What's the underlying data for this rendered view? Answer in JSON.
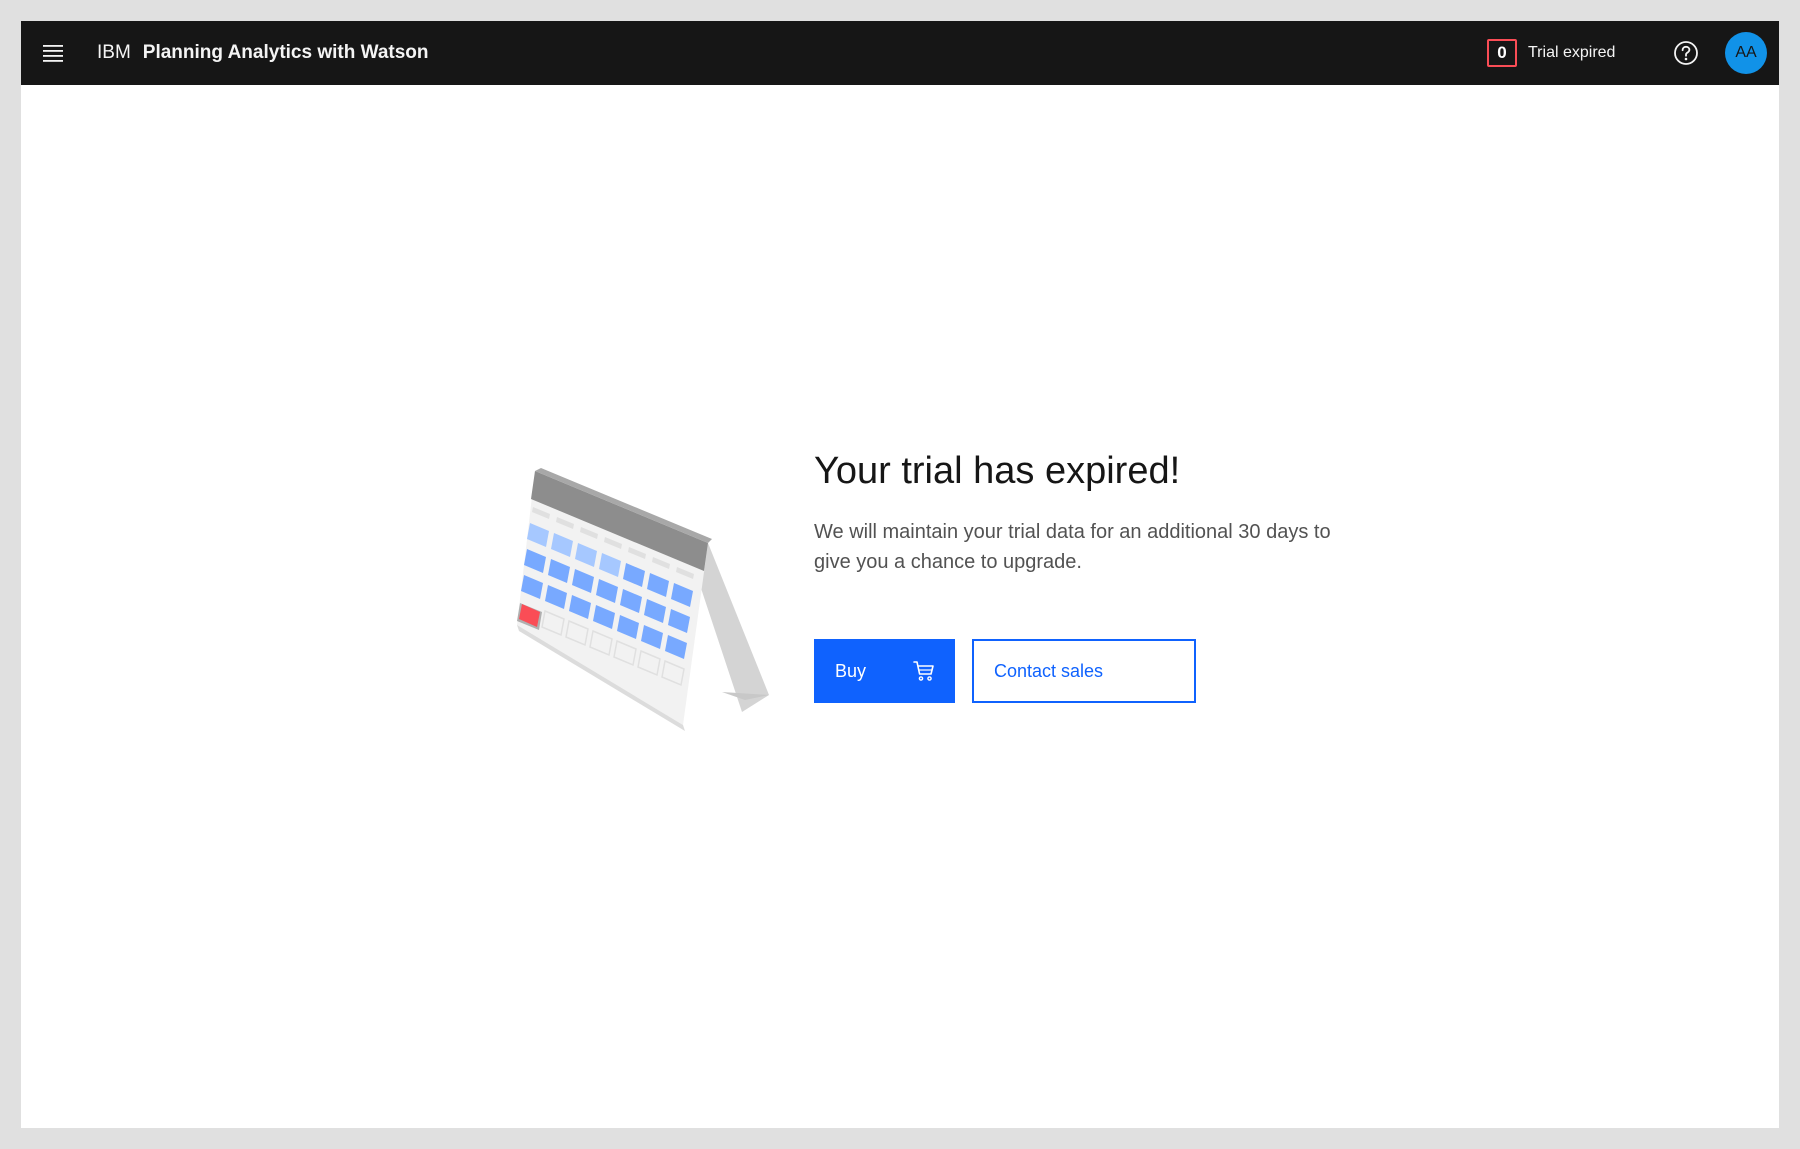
{
  "header": {
    "company": "IBM",
    "product": "Planning Analytics with Watson",
    "trial_days_remaining": "0",
    "trial_status": "Trial expired",
    "avatar_initials": "AA",
    "menu_icon": "hamburger-menu-icon",
    "help_icon": "help-icon"
  },
  "main": {
    "headline": "Your trial has expired!",
    "body": "We will maintain your trial data for an additional 30 days to give you a chance to upgrade.",
    "buy_label": "Buy",
    "buy_icon": "shopping-cart-icon",
    "contact_label": "Contact sales",
    "illustration": "calendar-illustration"
  },
  "colors": {
    "topbar_bg": "#161616",
    "primary_blue": "#0f62fe",
    "avatar_blue": "#1192e8",
    "badge_red": "#fa4d56",
    "text_primary": "#161616",
    "text_secondary": "#525252"
  }
}
